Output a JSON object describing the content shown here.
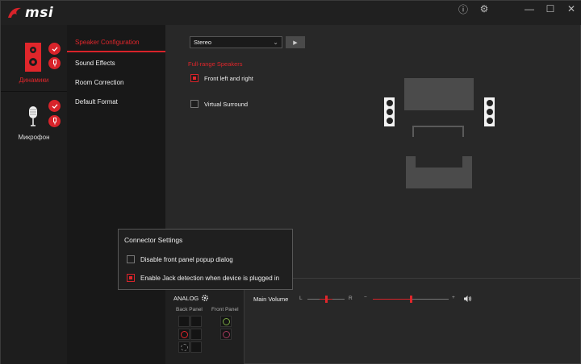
{
  "app": {
    "logo_text": "msi"
  },
  "titlebar": {
    "info_glyph": "ⓘ",
    "settings_glyph": "⚙",
    "minimize_glyph": "—",
    "maximize_glyph": "☐",
    "close_glyph": "✕"
  },
  "devices": {
    "speakers_label": "Динамики",
    "microphone_label": "Микрофон"
  },
  "tabs": [
    {
      "label": "Speaker Configuration"
    },
    {
      "label": "Sound Effects"
    },
    {
      "label": "Room Correction"
    },
    {
      "label": "Default Format"
    }
  ],
  "speaker_config": {
    "selected_config": "Stereo",
    "section_label": "Full-range Speakers",
    "front_lr_label": "Front left and right",
    "front_lr_checked": true,
    "virtual_surround_label": "Virtual Surround",
    "virtual_surround_checked": false
  },
  "popup": {
    "title": "Connector Settings",
    "disable_front_label": "Disable front panel popup dialog",
    "disable_front_checked": false,
    "jack_detect_label": "Enable Jack detection when device is plugged in",
    "jack_detect_checked": true
  },
  "analog": {
    "title": "ANALOG",
    "back_panel_label": "Back Panel",
    "front_panel_label": "Front Panel"
  },
  "volume": {
    "label": "Main Volume",
    "left_label": "L",
    "right_label": "R",
    "minus_label": "−",
    "plus_label": "+",
    "balance": 0.5,
    "level": 0.5
  },
  "colors": {
    "accent": "#d8232a",
    "green_jack": "#7aa843",
    "pink_jack": "#a33a5c",
    "red_jack": "#e0262b"
  }
}
